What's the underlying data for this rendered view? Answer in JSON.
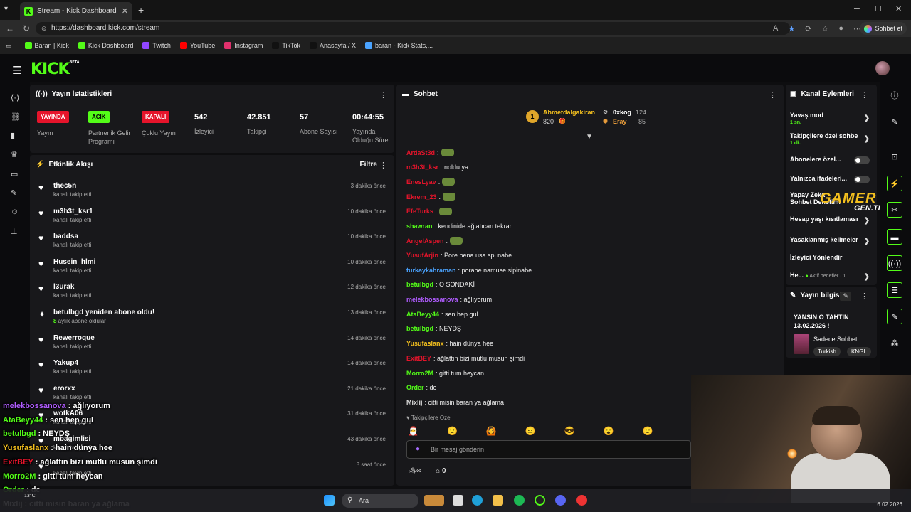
{
  "browser": {
    "tab_title": "Stream - Kick Dashboard",
    "url": "https://dashboard.kick.com/stream",
    "copilot_label": "Sohbet et",
    "bookmarks": [
      "Baran | Kick",
      "Kick Dashboard",
      "Twitch",
      "YouTube",
      "Instagram",
      "TikTok",
      "Anasayfa / X",
      "baran - Kick Stats,..."
    ]
  },
  "kick": {
    "logo": "KICK",
    "beta": "BETA"
  },
  "stats": {
    "title": "Yayın İstatistikleri",
    "items": [
      {
        "badge": "YAYINDA",
        "label": "Yayın",
        "color": "#e5142b"
      },
      {
        "badge": "ACIK",
        "label": "Partnerlik Gelir Programı",
        "color": "#53fc18"
      },
      {
        "badge": "KAPALI",
        "label": "Çoklu Yayın",
        "color": "#e5142b"
      }
    ],
    "numbers": [
      {
        "value": "542",
        "label": "İzleyici"
      },
      {
        "value": "42.851",
        "label": "Takipçi"
      },
      {
        "value": "57",
        "label": "Abone Sayısı"
      },
      {
        "value": "00:44:55",
        "label": "Yayında Olduğu Süre"
      }
    ]
  },
  "activity": {
    "title": "Etkinlik Akışı",
    "filter": "Filtre",
    "items": [
      {
        "name": "thec5n",
        "sub": "kanalı takip etti",
        "time": "3 dakika önce"
      },
      {
        "name": "m3h3t_ksr1",
        "sub": "kanalı takip etti",
        "time": "10 dakika önce"
      },
      {
        "name": "baddsa",
        "sub": "kanalı takip etti",
        "time": "10 dakika önce"
      },
      {
        "name": "Husein_hlmi",
        "sub": "kanalı takip etti",
        "time": "10 dakika önce"
      },
      {
        "name": "l3urak",
        "sub": "kanalı takip etti",
        "time": "12 dakika önce"
      },
      {
        "name": "betulbgd yeniden abone oldu!",
        "sub_num": "8",
        "sub": " aylık abone oldular",
        "time": "13 dakika önce"
      },
      {
        "name": "Rewerroque",
        "sub": "kanalı takip etti",
        "time": "14 dakika önce"
      },
      {
        "name": "Yakup4",
        "sub": "kanalı takip etti",
        "time": "14 dakika önce"
      },
      {
        "name": "erorxx",
        "sub": "kanalı takip etti",
        "time": "21 dakika önce"
      },
      {
        "name": "wotkA06",
        "sub": "kanalı takip etti",
        "time": "31 dakika önce"
      },
      {
        "name": "mbagimlisi",
        "sub": "kanalı takip etti",
        "time": "43 dakika önce"
      },
      {
        "name": "",
        "sub": "kanalı takip etti",
        "time": "8 saat önce"
      }
    ]
  },
  "chat": {
    "title": "Sohbet",
    "pinned": {
      "rank": "1",
      "user": "Ahmetdalgakiran",
      "amount": "820",
      "user2": "0xkog",
      "amount2": "124",
      "user3": "Eray",
      "amount3": "85"
    },
    "messages": [
      {
        "user": "ArdaSt3d",
        "text": ":",
        "color": "#e5142b",
        "emote": true
      },
      {
        "user": "m3h3t_ksr",
        "text": ": noldu ya",
        "color": "#e5142b"
      },
      {
        "user": "EnesLyav",
        "text": ":",
        "color": "#e5142b",
        "emote": true
      },
      {
        "user": "Ekrem_23",
        "text": ":",
        "color": "#e5142b",
        "emote": true
      },
      {
        "user": "EfeTurks",
        "text": ":",
        "color": "#e5142b",
        "emote": true
      },
      {
        "user": "shawran",
        "text": ": kendinide ağlatıcan tekrar",
        "color": "#53fc18"
      },
      {
        "user": "AngelAspen",
        "text": ":",
        "color": "#e5142b",
        "emote": true
      },
      {
        "user": "YusufArjin",
        "text": ": Pore bena usa spi nabe",
        "color": "#e5142b"
      },
      {
        "user": "turkaykahraman",
        "text": ": porabe namuse sipinabe",
        "color": "#4aa3ff"
      },
      {
        "user": "betulbgd",
        "text": ": O SONDAKİ",
        "color": "#53fc18"
      },
      {
        "user": "melekbossanova",
        "text": ": ağlıyorum",
        "color": "#b05cff"
      },
      {
        "user": "AtaBeyy44",
        "text": ": sen hep gul",
        "color": "#53fc18"
      },
      {
        "user": "betulbgd",
        "text": ": NEYDŞ",
        "color": "#53fc18"
      },
      {
        "user": "Yusufaslanx",
        "text": ": hain dünya hee",
        "color": "#f4c01e"
      },
      {
        "user": "ExitBEY",
        "text": ": ağlattın bizi mutlu musun şimdi",
        "color": "#e5142b"
      },
      {
        "user": "Morro2M",
        "text": ": gitti tum heycan",
        "color": "#53fc18"
      },
      {
        "user": "Order",
        "text": ": dc",
        "color": "#53fc18"
      },
      {
        "user": "Mixlij",
        "text": ": citti misin baran ya ağlama",
        "color": "#dddddd"
      }
    ],
    "subs_label": "Takipçilere Özel",
    "input_placeholder": "Bir mesaj gönderin",
    "points": "0"
  },
  "channel": {
    "title": "Kanal Eylemleri",
    "items": [
      {
        "label": "Yavaş mod",
        "sub": "1 sn."
      },
      {
        "label": "Takipçilere özel sohbe",
        "sub": "1 dk."
      },
      {
        "label": "Abonelere özel..."
      },
      {
        "label": "Yalnızca ifadeleri..."
      },
      {
        "label": "Yapay Zeka Sohbet Denetimi"
      },
      {
        "label": "Hesap yaşı kısıtlaması"
      },
      {
        "label": "Yasaklanmış kelimeler"
      },
      {
        "label": "İzleyici Yönlendir"
      },
      {
        "label": "He...",
        "sub": "Aktif hedefler · 1"
      }
    ]
  },
  "stream_info": {
    "title": "Yayın bilgisi",
    "stream_title": "YANSIN O TAHTIN 13.02.2026 !",
    "category": "Sadece Sohbet",
    "tags": [
      "Turkish",
      "KNGL"
    ]
  },
  "overlay_watermark": {
    "main": "GAMER",
    "sub": "GEN.TR"
  },
  "overlay_chat": [
    {
      "user": "melekbossanova",
      "text": ": ağlıyorum",
      "color": "#b05cff"
    },
    {
      "user": "AtaBeyy44",
      "text": ": sen hep gul",
      "color": "#53fc18"
    },
    {
      "user": "betulbgd",
      "text": ": NEYDŞ",
      "color": "#53fc18"
    },
    {
      "user": "Yusufaslanx",
      "text": ": hain dünya hee",
      "color": "#f4c01e"
    },
    {
      "user": "ExitBEY",
      "text": ": ağlattın bizi mutlu musun şimdi",
      "color": "#e5142b"
    },
    {
      "user": "Morro2M",
      "text": ": gitti tum heycan",
      "color": "#53fc18"
    },
    {
      "user": "Order",
      "text": ": dc",
      "color": "#53fc18"
    },
    {
      "user": "Mixlij",
      "text": ": citti misin baran ya ağlama",
      "color": "#ffffff"
    }
  ],
  "taskbar": {
    "search": "Ara",
    "weather": "13°C",
    "date": "6.02.2026"
  }
}
